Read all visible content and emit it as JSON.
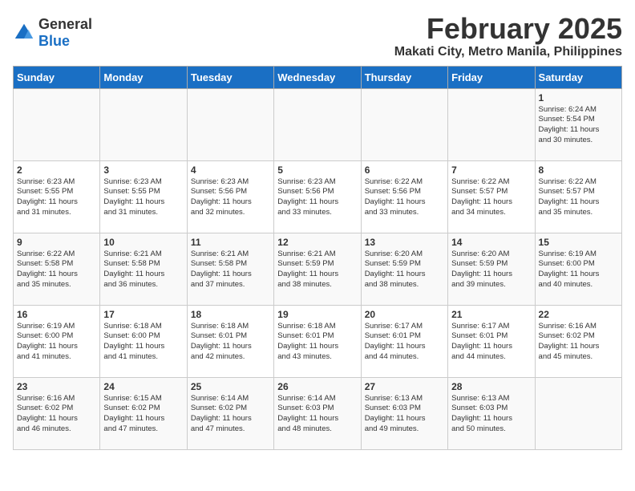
{
  "header": {
    "logo_general": "General",
    "logo_blue": "Blue",
    "month": "February 2025",
    "location": "Makati City, Metro Manila, Philippines"
  },
  "days_of_week": [
    "Sunday",
    "Monday",
    "Tuesday",
    "Wednesday",
    "Thursday",
    "Friday",
    "Saturday"
  ],
  "weeks": [
    [
      {
        "day": "",
        "info": ""
      },
      {
        "day": "",
        "info": ""
      },
      {
        "day": "",
        "info": ""
      },
      {
        "day": "",
        "info": ""
      },
      {
        "day": "",
        "info": ""
      },
      {
        "day": "",
        "info": ""
      },
      {
        "day": "1",
        "info": "Sunrise: 6:24 AM\nSunset: 5:54 PM\nDaylight: 11 hours\nand 30 minutes."
      }
    ],
    [
      {
        "day": "2",
        "info": "Sunrise: 6:23 AM\nSunset: 5:55 PM\nDaylight: 11 hours\nand 31 minutes."
      },
      {
        "day": "3",
        "info": "Sunrise: 6:23 AM\nSunset: 5:55 PM\nDaylight: 11 hours\nand 31 minutes."
      },
      {
        "day": "4",
        "info": "Sunrise: 6:23 AM\nSunset: 5:56 PM\nDaylight: 11 hours\nand 32 minutes."
      },
      {
        "day": "5",
        "info": "Sunrise: 6:23 AM\nSunset: 5:56 PM\nDaylight: 11 hours\nand 33 minutes."
      },
      {
        "day": "6",
        "info": "Sunrise: 6:22 AM\nSunset: 5:56 PM\nDaylight: 11 hours\nand 33 minutes."
      },
      {
        "day": "7",
        "info": "Sunrise: 6:22 AM\nSunset: 5:57 PM\nDaylight: 11 hours\nand 34 minutes."
      },
      {
        "day": "8",
        "info": "Sunrise: 6:22 AM\nSunset: 5:57 PM\nDaylight: 11 hours\nand 35 minutes."
      }
    ],
    [
      {
        "day": "9",
        "info": "Sunrise: 6:22 AM\nSunset: 5:58 PM\nDaylight: 11 hours\nand 35 minutes."
      },
      {
        "day": "10",
        "info": "Sunrise: 6:21 AM\nSunset: 5:58 PM\nDaylight: 11 hours\nand 36 minutes."
      },
      {
        "day": "11",
        "info": "Sunrise: 6:21 AM\nSunset: 5:58 PM\nDaylight: 11 hours\nand 37 minutes."
      },
      {
        "day": "12",
        "info": "Sunrise: 6:21 AM\nSunset: 5:59 PM\nDaylight: 11 hours\nand 38 minutes."
      },
      {
        "day": "13",
        "info": "Sunrise: 6:20 AM\nSunset: 5:59 PM\nDaylight: 11 hours\nand 38 minutes."
      },
      {
        "day": "14",
        "info": "Sunrise: 6:20 AM\nSunset: 5:59 PM\nDaylight: 11 hours\nand 39 minutes."
      },
      {
        "day": "15",
        "info": "Sunrise: 6:19 AM\nSunset: 6:00 PM\nDaylight: 11 hours\nand 40 minutes."
      }
    ],
    [
      {
        "day": "16",
        "info": "Sunrise: 6:19 AM\nSunset: 6:00 PM\nDaylight: 11 hours\nand 41 minutes."
      },
      {
        "day": "17",
        "info": "Sunrise: 6:18 AM\nSunset: 6:00 PM\nDaylight: 11 hours\nand 41 minutes."
      },
      {
        "day": "18",
        "info": "Sunrise: 6:18 AM\nSunset: 6:01 PM\nDaylight: 11 hours\nand 42 minutes."
      },
      {
        "day": "19",
        "info": "Sunrise: 6:18 AM\nSunset: 6:01 PM\nDaylight: 11 hours\nand 43 minutes."
      },
      {
        "day": "20",
        "info": "Sunrise: 6:17 AM\nSunset: 6:01 PM\nDaylight: 11 hours\nand 44 minutes."
      },
      {
        "day": "21",
        "info": "Sunrise: 6:17 AM\nSunset: 6:01 PM\nDaylight: 11 hours\nand 44 minutes."
      },
      {
        "day": "22",
        "info": "Sunrise: 6:16 AM\nSunset: 6:02 PM\nDaylight: 11 hours\nand 45 minutes."
      }
    ],
    [
      {
        "day": "23",
        "info": "Sunrise: 6:16 AM\nSunset: 6:02 PM\nDaylight: 11 hours\nand 46 minutes."
      },
      {
        "day": "24",
        "info": "Sunrise: 6:15 AM\nSunset: 6:02 PM\nDaylight: 11 hours\nand 47 minutes."
      },
      {
        "day": "25",
        "info": "Sunrise: 6:14 AM\nSunset: 6:02 PM\nDaylight: 11 hours\nand 47 minutes."
      },
      {
        "day": "26",
        "info": "Sunrise: 6:14 AM\nSunset: 6:03 PM\nDaylight: 11 hours\nand 48 minutes."
      },
      {
        "day": "27",
        "info": "Sunrise: 6:13 AM\nSunset: 6:03 PM\nDaylight: 11 hours\nand 49 minutes."
      },
      {
        "day": "28",
        "info": "Sunrise: 6:13 AM\nSunset: 6:03 PM\nDaylight: 11 hours\nand 50 minutes."
      },
      {
        "day": "",
        "info": ""
      }
    ]
  ]
}
